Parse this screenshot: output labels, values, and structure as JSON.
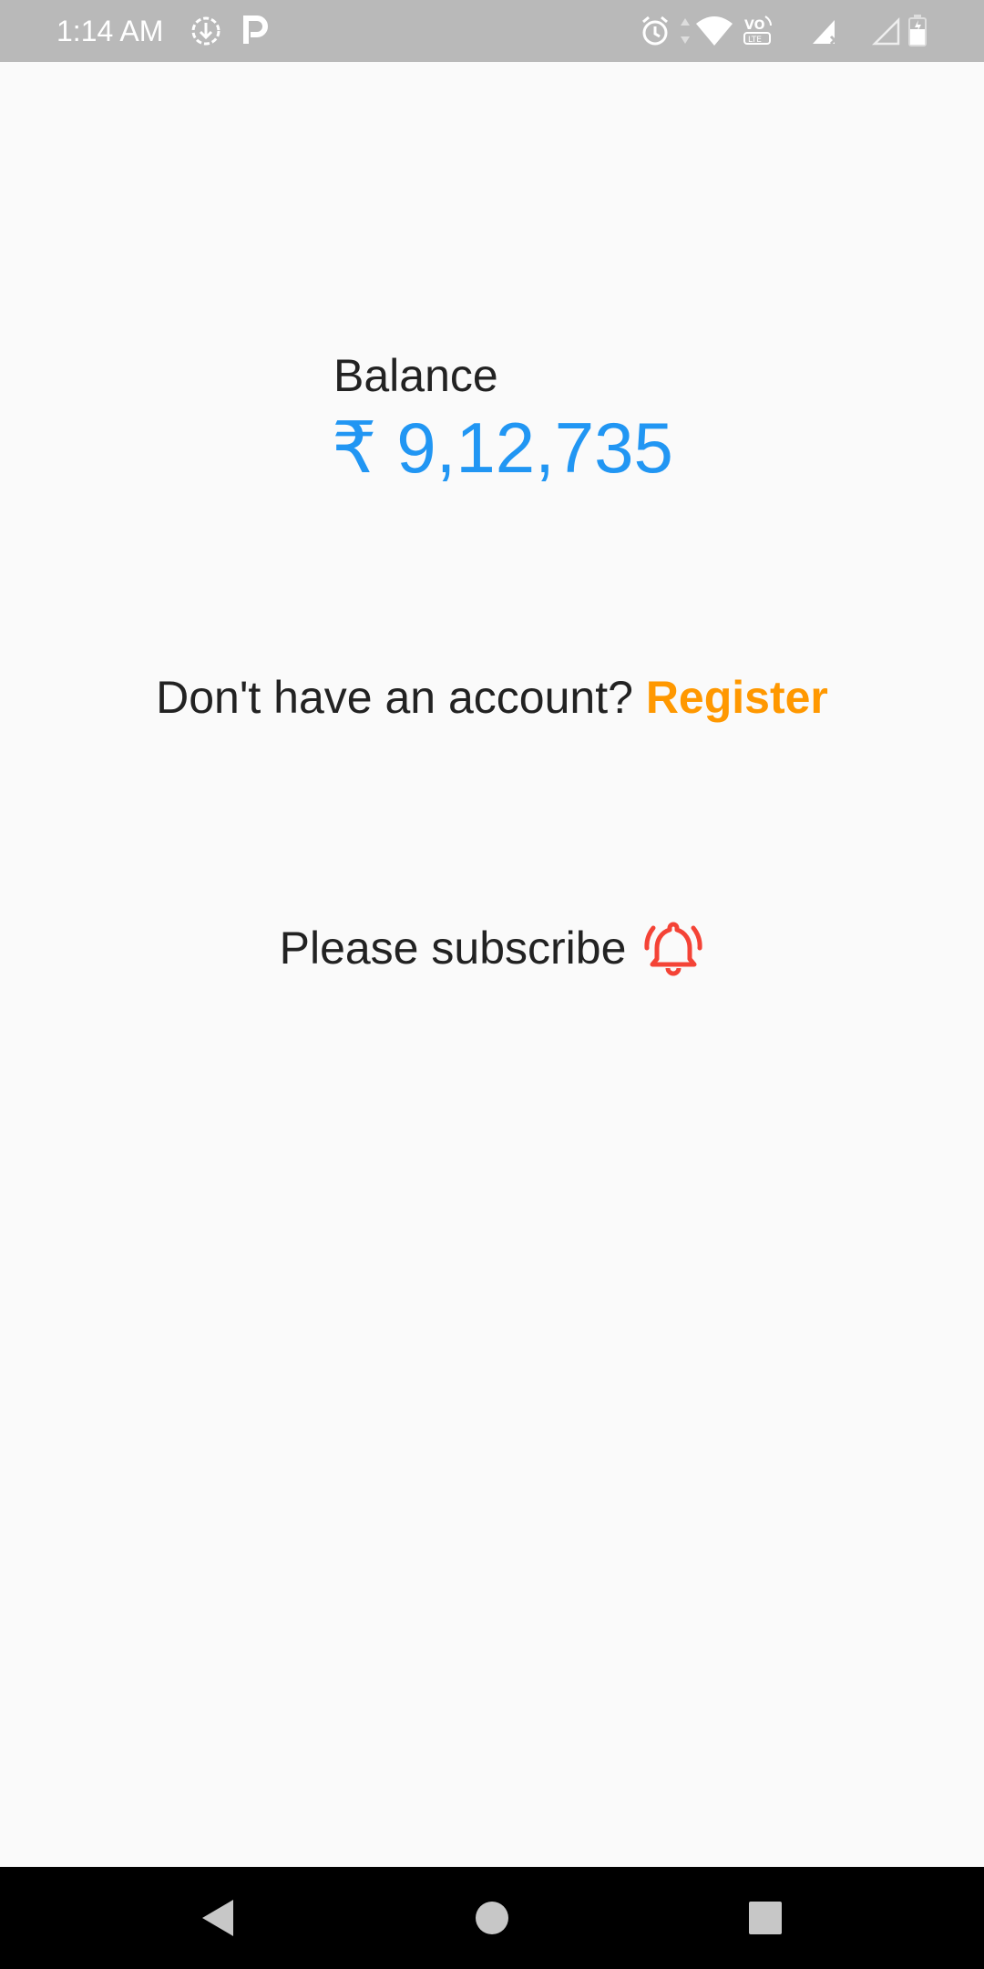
{
  "status_bar": {
    "time": "1:14 AM",
    "icons": [
      "download-icon",
      "parking-app-icon",
      "alarm-icon",
      "data-arrows-icon",
      "wifi-icon",
      "volte-icon",
      "signal-x-icon",
      "signal-empty-icon",
      "battery-icon"
    ],
    "background": "#b9b9b9"
  },
  "balance": {
    "label": "Balance",
    "amount": "₹ 9,12,735",
    "amount_color": "#2196f3"
  },
  "register": {
    "prompt": "Don't have an account?",
    "link_label": "Register",
    "link_color": "#ff9800"
  },
  "subscribe": {
    "label": "Please subscribe",
    "icon": "bell-ringing-icon",
    "icon_color": "#f44336"
  },
  "nav_bar": {
    "buttons": [
      "back-icon",
      "home-icon",
      "recents-icon"
    ]
  }
}
